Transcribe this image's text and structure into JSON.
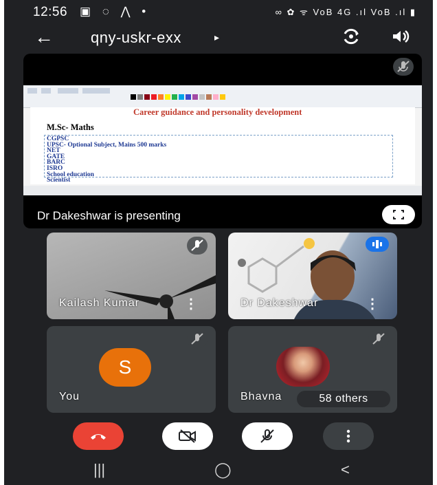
{
  "status_bar": {
    "time": "12:56",
    "left_icons": "▣ ◌ ⋀ •",
    "right_icons": "∞ ✿ ᯤ VoB 4G .ıl VoB .ıl ▮"
  },
  "meeting": {
    "code": "qny-uskr-exx",
    "presenting_label": "Dr Dakeshwar is presenting"
  },
  "slide": {
    "title": "Career guidance and personality development",
    "heading": "M.Sc- Maths",
    "items": [
      "CGPSC",
      "UPSC- Optional Subject, Mains 500 marks",
      "NET",
      "GATE",
      "BARC",
      "ISRO",
      "School education",
      "Scientist"
    ]
  },
  "participants": [
    {
      "name": "Kailash Kumar"
    },
    {
      "name": "Dr Dakeshwar"
    },
    {
      "name": "You",
      "initial": "S"
    },
    {
      "name": "Bhavna",
      "others": "58 others"
    }
  ],
  "colors": {
    "background": "#202124",
    "tile": "#3c4043",
    "end_call": "#ea4335",
    "avatar": "#e8710a",
    "speaking": "#1a73e8"
  },
  "icons": {
    "back": "←",
    "caret": "▸",
    "more": "⋮",
    "nav_recents": "|||",
    "nav_home": "◯",
    "nav_back": "<"
  }
}
